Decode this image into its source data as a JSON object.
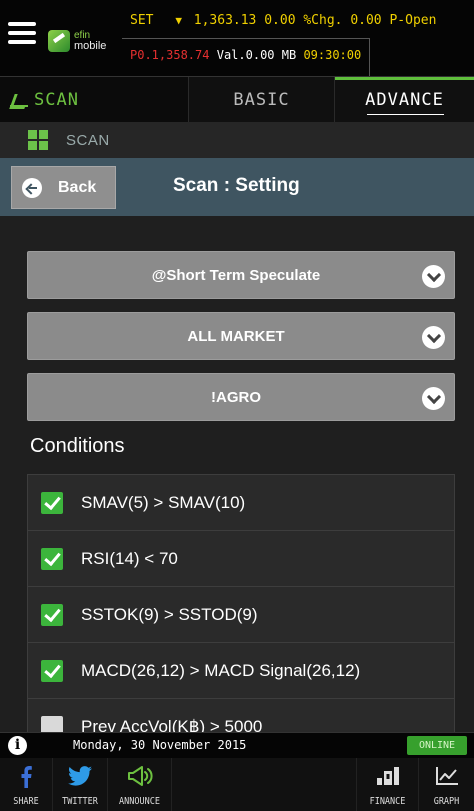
{
  "ticker": {
    "market": "SET",
    "index": "1,363.13",
    "change": "0.00",
    "pct_change": "%Chg. 0.00",
    "status": "P-Open",
    "prev_close": "P0.1,358.74",
    "volume": "Val.0.00 MB",
    "time": "09:30:00"
  },
  "logo": {
    "top": "efin",
    "bottom": "mobile"
  },
  "tabs": {
    "scan": "SCAN",
    "basic": "BASIC",
    "advance": "ADVANCE"
  },
  "breadcrumb": {
    "label": "SCAN"
  },
  "header": {
    "back": "Back",
    "title": "Scan : Setting"
  },
  "selects": [
    {
      "value": "@Short Term Speculate"
    },
    {
      "value": "ALL MARKET"
    },
    {
      "value": "!AGRO"
    }
  ],
  "conditions": {
    "title": "Conditions",
    "items": [
      {
        "text": "SMAV(5) > SMAV(10)",
        "checked": true
      },
      {
        "text": "RSI(14) < 70",
        "checked": true
      },
      {
        "text": "SSTOK(9) > SSTOD(9)",
        "checked": true
      },
      {
        "text": "MACD(26,12) > MACD Signal(26,12)",
        "checked": true
      },
      {
        "text": "Prev AccVol(K฿) > 5000",
        "checked": false
      }
    ]
  },
  "status": {
    "date": "Monday, 30 November 2015",
    "online": "ONLINE"
  },
  "bottom_nav": {
    "share": "SHARE",
    "twitter": "TWITTER",
    "announce": "ANNOUNCE",
    "finance": "FINANCE",
    "graph": "GRAPH"
  },
  "colors": {
    "accent": "#5fbf3c",
    "header": "#3f5561",
    "select": "#8b8b8b",
    "check": "#3cb53c"
  }
}
